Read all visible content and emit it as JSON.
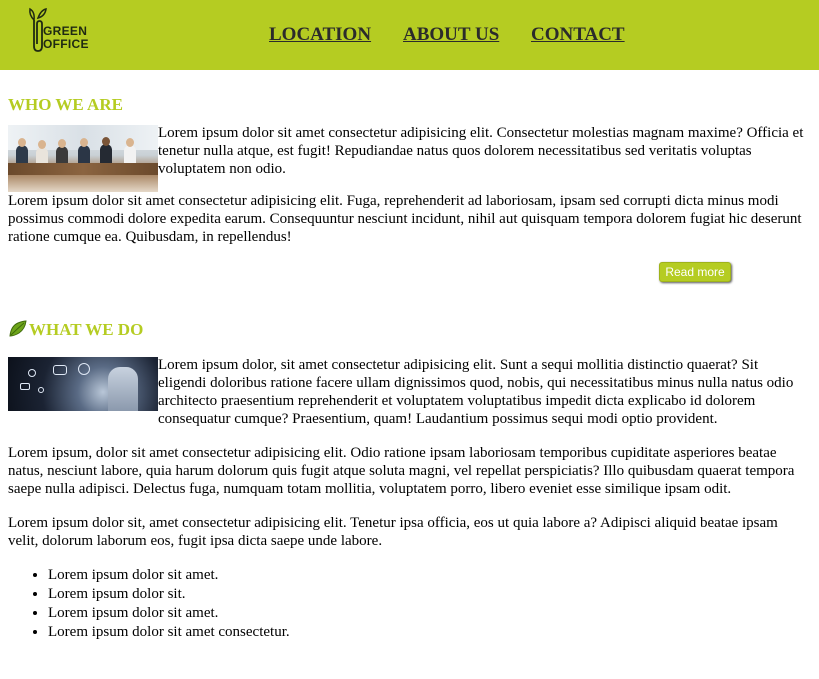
{
  "header": {
    "logo_text_line1": "GREEN",
    "logo_text_line2": "OFFICE",
    "nav": [
      {
        "label": "LOCATION"
      },
      {
        "label": "ABOUT US"
      },
      {
        "label": "CONTACT"
      }
    ],
    "accent_color": "#b5cc22"
  },
  "who_we_are": {
    "title": "WHO WE ARE",
    "paragraph1": "Lorem ipsum dolor sit amet consectetur adipisicing elit. Consectetur molestias magnam maxime? Officia et tenetur nulla atque, est fugit! Repudiandae natus quos dolorem necessitatibus sed veritatis voluptas voluptatem non odio.",
    "paragraph2": "Lorem ipsum dolor sit amet consectetur adipisicing elit. Fuga, reprehenderit ad laboriosam, ipsam sed corrupti dicta minus modi possimus commodi dolore expedita earum. Consequuntur nesciunt incidunt, nihil aut quisquam tempora dolorem fugiat hic deserunt ratione cumque ea. Quibusdam, in repellendus!",
    "read_more": "Read more",
    "image_icon": "business-team-photo"
  },
  "what_we_do": {
    "title": "WHAT WE DO",
    "title_icon": "leaf-icon",
    "paragraph1": "Lorem ipsum dolor, sit amet consectetur adipisicing elit. Sunt a sequi mollitia distinctio quaerat? Sit eligendi doloribus ratione facere ullam dignissimos quod, nobis, qui necessitatibus minus nulla natus odio architecto praesentium reprehenderit et voluptatem voluptatibus impedit dicta explicabo id dolorem consequatur cumque? Praesentium, quam! Laudantium possimus sequi modi optio provident.",
    "paragraph2": "Lorem ipsum, dolor sit amet consectetur adipisicing elit. Odio ratione ipsam laboriosam temporibus cupiditate asperiores beatae natus, nesciunt labore, quia harum dolorum quis fugit atque soluta magni, vel repellat perspiciatis? Illo quibusdam quaerat tempora saepe nulla adipisci. Delectus fuga, numquam totam mollitia, voluptatem porro, libero eveniet esse similique ipsam odit.",
    "paragraph3": "Lorem ipsum dolor sit, amet consectetur adipisicing elit. Tenetur ipsa officia, eos ut quia labore a? Adipisci aliquid beatae ipsam velit, dolorum laborum eos, fugit ipsa dicta saepe unde labore.",
    "list": [
      "Lorem ipsum dolor sit amet.",
      "Lorem ipsum dolor sit.",
      "Lorem ipsum dolor sit amet.",
      "Lorem ipsum dolor sit amet consectetur."
    ],
    "image_icon": "technology-hand-photo"
  }
}
